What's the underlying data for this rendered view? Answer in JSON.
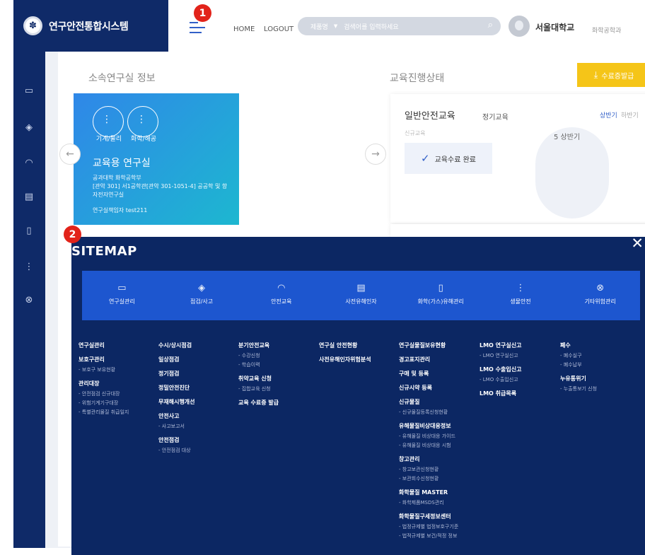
{
  "app": {
    "title": "연구안전통합시스템",
    "logo_glyph": "✽"
  },
  "topbar": {
    "home": "HOME",
    "logout": "LOGOUT",
    "search_select": "제품명",
    "search_placeholder": "검색어를 입력하세요",
    "university": "서울대학교",
    "department": "화학공학과"
  },
  "callouts": {
    "one": "1",
    "two": "2"
  },
  "sidebar_icons": [
    "monitor-icon",
    "shield-icon",
    "helmet-icon",
    "computer-icon",
    "flask-icon",
    "dna-icon",
    "biohazard-icon"
  ],
  "lab_info": {
    "section_title": "소속연구실 정보",
    "categories": [
      "기계/물리",
      "화학/해공"
    ],
    "lab_name": "교육용 연구실",
    "line1": "공과대학 화학공학부",
    "line2": "[관악 301] 서1공학관[관악 301-1051-4] 공공학 및 항",
    "line3": "자전자연구실",
    "manager": "연구실책임자 test211"
  },
  "education": {
    "section_title": "교육진행상태",
    "cert_button": "수료증발급",
    "name": "일반안전교육",
    "type": "정기교육",
    "half_first": "상반기",
    "half_second": "하반기",
    "small": "신규교육",
    "done_label": "교육수료 완료",
    "circle_label": "5 상반기"
  },
  "sitemap": {
    "title": "SITEMAP",
    "close": "✕",
    "categories": [
      {
        "label": "연구실관리",
        "icon": "monitor-icon",
        "glyph": "▭"
      },
      {
        "label": "점검/사고",
        "icon": "shield-icon",
        "glyph": "◈"
      },
      {
        "label": "안전교육",
        "icon": "helmet-icon",
        "glyph": "◠"
      },
      {
        "label": "사전유해인자",
        "icon": "computer-icon",
        "glyph": "▤"
      },
      {
        "label": "화학(가스)유해관리",
        "icon": "flask-icon",
        "glyph": "▯"
      },
      {
        "label": "생물안전",
        "icon": "dna-icon",
        "glyph": "⋮"
      },
      {
        "label": "기타위험관리",
        "icon": "biohazard-icon",
        "glyph": "⊗"
      }
    ],
    "columns": [
      {
        "groups": [
          {
            "title": "연구실관리",
            "items": []
          },
          {
            "title": "보호구관리",
            "items": [
              "- 보호구 보유현황"
            ]
          },
          {
            "title": "관리대장",
            "items": [
              "- 안전점검 신규대장",
              "- 위험기계기구대장",
              "- 특별관리물질 취급일지"
            ]
          }
        ]
      },
      {
        "groups": [
          {
            "title": "수시/상시점검",
            "items": []
          },
          {
            "title": "일상점검",
            "items": []
          },
          {
            "title": "정기점검",
            "items": []
          },
          {
            "title": "정밀안전진단",
            "items": []
          },
          {
            "title": "무재해시행개선",
            "items": []
          },
          {
            "title": "안전사고",
            "items": [
              "- 사고보고서"
            ]
          },
          {
            "title": "안전점검",
            "items": [
              "- 안전점검 대상"
            ]
          }
        ]
      },
      {
        "groups": [
          {
            "title": "분기안전교육",
            "items": [
              "- 수강신청",
              "- 학습이력"
            ]
          },
          {
            "title": "취약교육 신청",
            "items": [
              "- 집합교육 신청"
            ]
          },
          {
            "title": "교육 수료증 발급",
            "items": []
          }
        ]
      },
      {
        "groups": [
          {
            "title": "연구실 안전현황",
            "items": []
          },
          {
            "title": "사전유해인자위험분석",
            "items": []
          }
        ]
      },
      {
        "groups": [
          {
            "title": "연구실물질보유현황",
            "items": []
          },
          {
            "title": "경고표지관리",
            "items": []
          },
          {
            "title": "구매 및 등록",
            "items": []
          },
          {
            "title": "신규시약 등록",
            "items": []
          },
          {
            "title": "신규물질",
            "items": [
              "- 신규물질등록신청현황"
            ]
          },
          {
            "title": "유해물질비상대응정보",
            "items": [
              "- 유해물질 비상대응 가이드",
              "- 유해물질 비상대응 시험"
            ]
          },
          {
            "title": "창고관리",
            "items": [
              "- 창고보관신청현황",
              "- 보관회수신청현황"
            ]
          },
          {
            "title": "화학물질 MASTER",
            "items": [
              "- 화학제품MSDS관리"
            ]
          },
          {
            "title": "화학물질구세정보센터",
            "items": [
              "- 법정규제별 법정보호구기준",
              "- 법적규제별 보건/적정 정보"
            ]
          }
        ]
      },
      {
        "groups": [
          {
            "title": "LMO 연구실신고",
            "items": [
              "- LMO 연구실신고"
            ]
          },
          {
            "title": "LMO 수출입신고",
            "items": [
              "- LMO 수출입신고"
            ]
          },
          {
            "title": "LMO 취급목록",
            "items": []
          }
        ]
      },
      {
        "groups": [
          {
            "title": "폐수",
            "items": [
              "- 폐수실구",
              "- 폐수납부"
            ]
          },
          {
            "title": "누유통위기",
            "items": [
              "- 누출통보기 신청"
            ]
          }
        ]
      }
    ]
  }
}
